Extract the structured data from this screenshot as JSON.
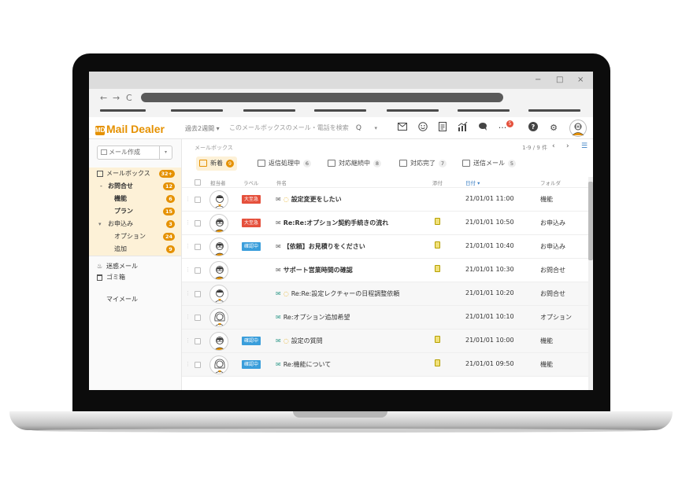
{
  "window": {
    "minimize_glyph": "−",
    "maximize_glyph": "□",
    "close_glyph": "×"
  },
  "browser": {
    "back_glyph": "←",
    "forward_glyph": "→",
    "reload_glyph": "C"
  },
  "app": {
    "logo_mark": "MD",
    "logo_text": "Mail Dealer",
    "period_filter": "過去2週間 ▾",
    "search_placeholder": "このメールボックスのメール・電話を検索",
    "search_icon": "Q",
    "search_dropdown": "▾",
    "notification_count": "5",
    "header_icons": [
      "mail-icon",
      "smiley-icon",
      "document-icon",
      "chart-icon",
      "chat-icon",
      "more-icon",
      "help-icon",
      "gear-icon",
      "user-avatar-icon"
    ]
  },
  "sidebar": {
    "compose_label": "メール作成",
    "compose_dropdown": "▾",
    "mailbox": {
      "label": "メールボックス",
      "badge": "32+"
    },
    "items": [
      {
        "label": "お問合せ",
        "badge": "12",
        "prefix": "-"
      },
      {
        "label": "機能",
        "badge": "6"
      },
      {
        "label": "プラン",
        "badge": "15"
      },
      {
        "label": "お申込み",
        "badge": "3",
        "prefix": "▾"
      },
      {
        "label": "オプション",
        "badge": "24"
      },
      {
        "label": "追加",
        "badge": "9"
      }
    ],
    "spam": "迷惑メール",
    "trash": "ゴミ箱",
    "mymail": "マイメール"
  },
  "main": {
    "title": "メールボックス",
    "pager": "1-9 / 9 件",
    "prev": "‹",
    "next": "›",
    "menu_glyph": "☰",
    "tabs": [
      {
        "label": "新着",
        "count": "9"
      },
      {
        "label": "返信処理中",
        "count": "6"
      },
      {
        "label": "対応継続中",
        "count": "8"
      },
      {
        "label": "対応完了",
        "count": "7"
      },
      {
        "label": "送信メール",
        "count": "5"
      }
    ],
    "columns": {
      "assignee": "担当者",
      "label": "ラベル",
      "subject": "件名",
      "attachment": "添付",
      "date": "日付 ▾",
      "folder": "フォルダ"
    },
    "colors": {
      "urgent": "#e5503c",
      "confirming": "#3a9edb",
      "accent": "#e59100"
    },
    "rows": [
      {
        "label": "大至急",
        "label_type": "urgent",
        "has_bubble": true,
        "read": false,
        "subject": "設定変更をしたい",
        "bold": true,
        "attach": false,
        "date": "21/01/01 11:00",
        "folder": "機能",
        "avatar": "male"
      },
      {
        "label": "大至急",
        "label_type": "urgent",
        "has_bubble": false,
        "read": false,
        "subject": "Re:Re:オプション契約手続きの流れ",
        "bold": true,
        "attach": true,
        "date": "21/01/01 10:50",
        "folder": "お申込み",
        "avatar": "male-glasses"
      },
      {
        "label": "確認中",
        "label_type": "confirming",
        "has_bubble": false,
        "read": false,
        "subject": "【依頼】お見積りをください",
        "bold": true,
        "attach": true,
        "date": "21/01/01 10:40",
        "folder": "お申込み",
        "avatar": "male-glasses"
      },
      {
        "label": "",
        "label_type": "",
        "has_bubble": false,
        "read": false,
        "subject": "サポート営業時間の確認",
        "bold": true,
        "attach": true,
        "date": "21/01/01 10:30",
        "folder": "お問合せ",
        "avatar": "male-glasses"
      },
      {
        "label": "",
        "label_type": "",
        "has_bubble": true,
        "read": true,
        "subject": "Re:Re:設定レクチャーの日程調整依頼",
        "bold": false,
        "attach": false,
        "date": "21/01/01 10:20",
        "folder": "お問合せ",
        "avatar": "male"
      },
      {
        "label": "",
        "label_type": "",
        "has_bubble": false,
        "read": true,
        "subject": "Re:オプション追加希望",
        "bold": false,
        "attach": false,
        "date": "21/01/01 10:10",
        "folder": "オプション",
        "avatar": "female"
      },
      {
        "label": "確認中",
        "label_type": "confirming",
        "has_bubble": true,
        "read": true,
        "subject": "設定の質問",
        "bold": false,
        "attach": true,
        "date": "21/01/01 10:00",
        "folder": "機能",
        "avatar": "male-glasses"
      },
      {
        "label": "確認中",
        "label_type": "confirming",
        "has_bubble": false,
        "read": true,
        "subject": "Re:機能について",
        "bold": false,
        "attach": true,
        "date": "21/01/01 09:50",
        "folder": "機能",
        "avatar": "female"
      }
    ]
  }
}
